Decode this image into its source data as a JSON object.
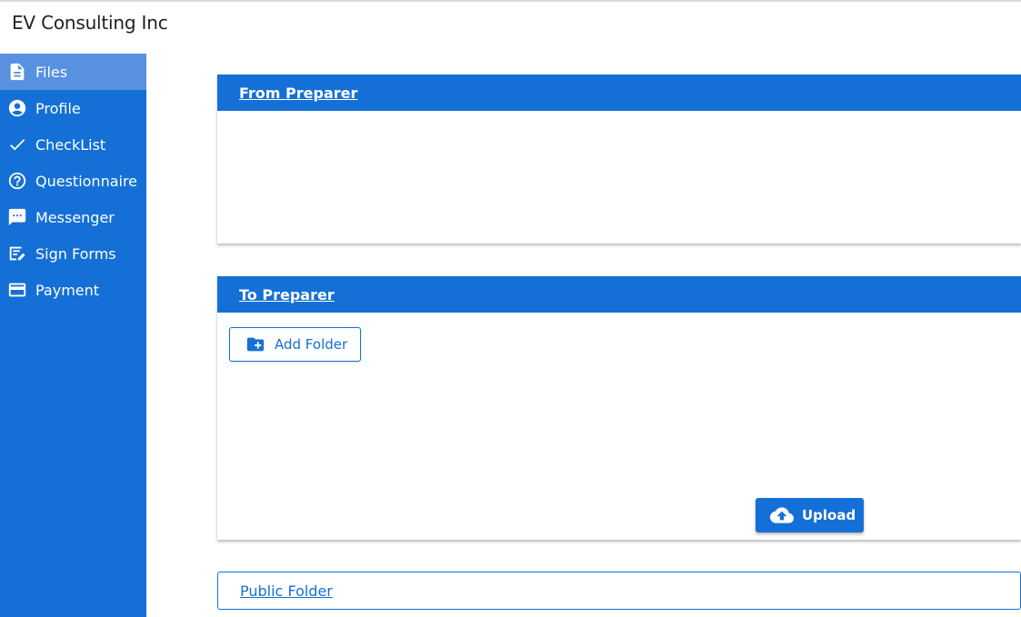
{
  "app": {
    "title": "EV Consulting Inc"
  },
  "sidebar": {
    "items": [
      {
        "label": "Files",
        "icon": "file-icon",
        "active": true
      },
      {
        "label": "Profile",
        "icon": "account-circle-icon"
      },
      {
        "label": "CheckList",
        "icon": "check-icon"
      },
      {
        "label": "Questionnaire",
        "icon": "help-circle-icon"
      },
      {
        "label": "Messenger",
        "icon": "message-icon"
      },
      {
        "label": "Sign Forms",
        "icon": "sign-form-icon"
      },
      {
        "label": "Payment",
        "icon": "credit-card-icon"
      }
    ]
  },
  "panels": {
    "from_preparer": {
      "title": "From Preparer"
    },
    "to_preparer": {
      "title": "To Preparer",
      "add_folder_label": "Add Folder",
      "upload_label": "Upload"
    },
    "public_folder": {
      "title": "Public Folder"
    }
  },
  "colors": {
    "primary": "#1470d6",
    "active_nav": "#5791e0"
  }
}
